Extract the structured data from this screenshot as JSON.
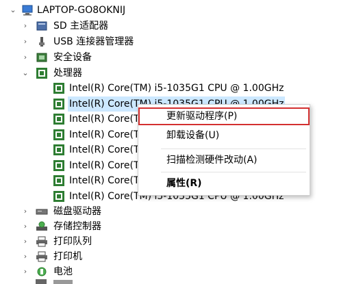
{
  "tree": {
    "root": {
      "label": "LAPTOP-GO8OKNIJ",
      "expanded": true
    },
    "categories_top": [
      {
        "label": "SD 主适配器",
        "icon": "sd-host-adapter-icon",
        "expanded": false
      },
      {
        "label": "USB 连接器管理器",
        "icon": "usb-connector-icon",
        "expanded": false
      },
      {
        "label": "安全设备",
        "icon": "security-device-icon",
        "expanded": false
      },
      {
        "label": "处理器",
        "icon": "processor-icon",
        "expanded": true
      }
    ],
    "processors": [
      "Intel(R) Core(TM) i5-1035G1 CPU @ 1.00GHz",
      "Intel(R) Core(TM) i5-1035G1 CPU @ 1.00GHz",
      "Intel(R) Core(TM) i5-1035G1 CPU @ 1.00GHz",
      "Intel(R) Core(TM) i5-1035G1 CPU @ 1.00GHz",
      "Intel(R) Core(TM) i5-1035G1 CPU @ 1.00GHz",
      "Intel(R) Core(TM) i5-1035G1 CPU @ 1.00GHz",
      "Intel(R) Core(TM) i5-1035G1 CPU @ 1.00GHz",
      "Intel(R) Core(TM) i5-1035G1 CPU @ 1.00GHz"
    ],
    "categories_bottom": [
      {
        "label": "磁盘驱动器",
        "icon": "disk-drive-icon",
        "expanded": false
      },
      {
        "label": "存储控制器",
        "icon": "storage-controller-icon",
        "expanded": false
      },
      {
        "label": "打印队列",
        "icon": "print-queue-icon",
        "expanded": false
      },
      {
        "label": "打印机",
        "icon": "printer-icon",
        "expanded": false
      },
      {
        "label": "电池",
        "icon": "battery-icon",
        "expanded": false
      }
    ]
  },
  "context_menu": {
    "items": [
      {
        "label": "更新驱动程序(P)",
        "highlighted": true
      },
      {
        "label": "卸载设备(U)"
      },
      {
        "label": "扫描检测硬件改动(A)"
      },
      {
        "label": "属性(R)",
        "bold": true
      }
    ]
  },
  "colors": {
    "selection": "#cce8ff",
    "highlight_box": "#d32f2f",
    "chip_green": "#2e7d32"
  }
}
